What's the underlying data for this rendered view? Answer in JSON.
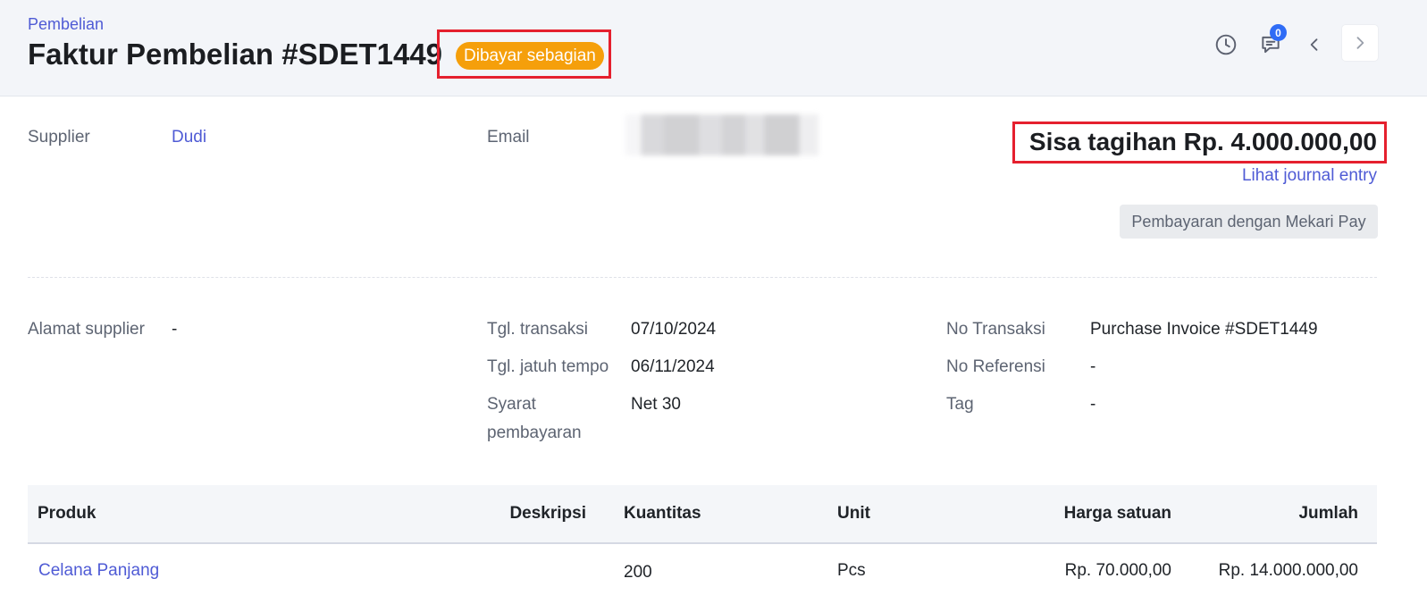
{
  "header": {
    "breadcrumb": "Pembelian",
    "title": "Faktur Pembelian #SDET1449",
    "status": "Dibayar sebagian",
    "comment_count": "0",
    "icons": [
      "history-icon",
      "comment-icon",
      "chevron-left-icon",
      "chevron-right-icon"
    ]
  },
  "supplier": {
    "label": "Supplier",
    "value": "Dudi"
  },
  "email": {
    "label": "Email"
  },
  "summary": {
    "balance": "Sisa tagihan Rp. 4.000.000,00",
    "journal_link": "Lihat journal entry",
    "pay_button": "Pembayaran dengan Mekari Pay"
  },
  "details": {
    "address_label": "Alamat supplier",
    "address_value": "-",
    "transaction_date_label": "Tgl. transaksi",
    "transaction_date": "07/10/2024",
    "due_date_label": "Tgl. jatuh tempo",
    "due_date": "06/11/2024",
    "terms_label_line1": "Syarat",
    "terms_label_line2": "pembayaran",
    "terms_value": "Net 30",
    "trx_no_label": "No Transaksi",
    "trx_no": "Purchase Invoice #SDET1449",
    "ref_label": "No Referensi",
    "ref_value": "-",
    "tag_label": "Tag",
    "tag_value": "-"
  },
  "table": {
    "columns": [
      "Produk",
      "Deskripsi",
      "Kuantitas",
      "Unit",
      "Harga satuan",
      "Jumlah"
    ],
    "rows": [
      {
        "product": "Celana Panjang",
        "description": "",
        "qty": "200",
        "unit": "Pcs",
        "price": "Rp. 70.000,00",
        "amount": "Rp. 14.000.000,00"
      }
    ]
  },
  "colors": {
    "accent": "#4f5bd5",
    "status": "#f59f0b",
    "highlight": "#e5202e",
    "badge": "#2f6cf6"
  }
}
